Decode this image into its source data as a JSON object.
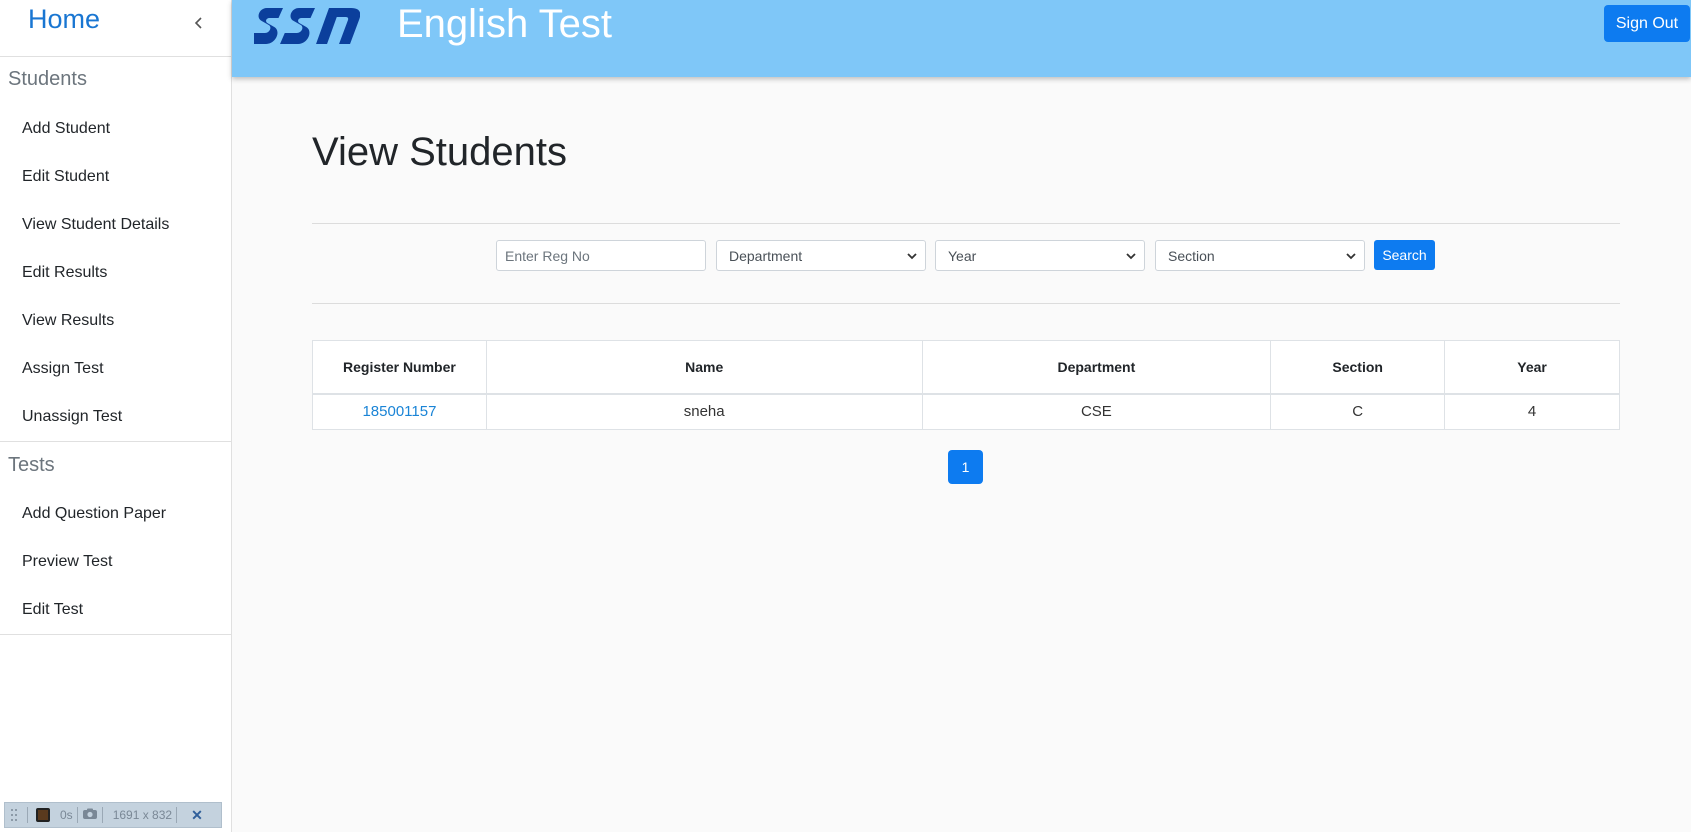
{
  "sidebar": {
    "home_label": "Home",
    "sections": [
      {
        "title": "Students",
        "items": [
          "Add Student",
          "Edit Student",
          "View Student Details",
          "Edit Results",
          "View Results",
          "Assign Test",
          "Unassign Test"
        ]
      },
      {
        "title": "Tests",
        "items": [
          "Add Question Paper",
          "Preview Test",
          "Edit Test"
        ]
      }
    ]
  },
  "header": {
    "logo_text": "SSN",
    "title": "English Test",
    "signout_label": "Sign Out"
  },
  "main": {
    "page_title": "View Students",
    "filters": {
      "reg_no_placeholder": "Enter Reg No",
      "department": "Department",
      "year": "Year",
      "section": "Section",
      "search_label": "Search"
    },
    "table": {
      "columns": [
        "Register Number",
        "Name",
        "Department",
        "Section",
        "Year"
      ],
      "rows": [
        {
          "register_number": "185001157",
          "name": "sneha",
          "department": "CSE",
          "section": "C",
          "year": "4"
        }
      ]
    },
    "pagination": {
      "current_page": "1"
    }
  },
  "toolbar": {
    "elapsed": "0s",
    "dimensions": "1691 x 832"
  },
  "colors": {
    "header_bg": "#7fc7f8",
    "primary": "#0d7bf0",
    "link": "#1a84d6",
    "logo": "#0b3f9c"
  }
}
